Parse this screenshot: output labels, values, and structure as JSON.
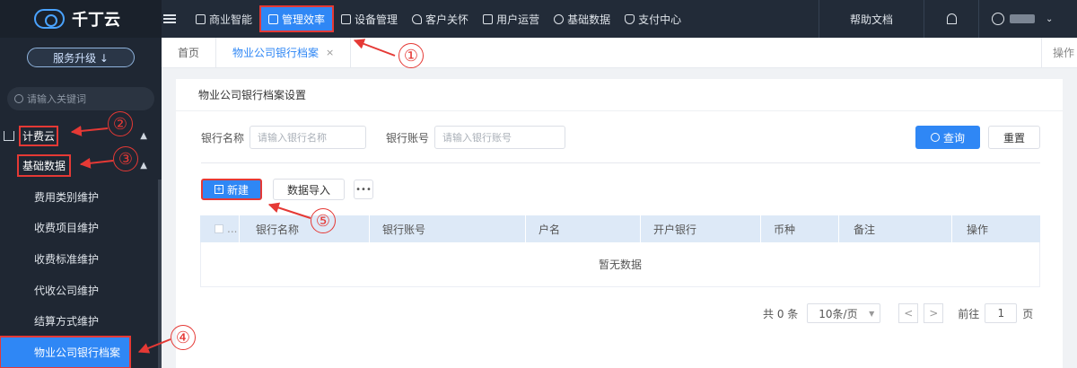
{
  "brand": {
    "name": "千丁云",
    "upgrade_label": "服务升级 ↓"
  },
  "sidebar": {
    "search_placeholder": "请输入关键词",
    "group1": "计费云",
    "group2": "基础数据",
    "items": [
      {
        "label": "费用类别维护"
      },
      {
        "label": "收费项目维护"
      },
      {
        "label": "收费标准维护"
      },
      {
        "label": "代收公司维护"
      },
      {
        "label": "结算方式维护"
      },
      {
        "label": "物业公司银行档案"
      }
    ]
  },
  "topnav": {
    "items": [
      {
        "label": "商业智能"
      },
      {
        "label": "管理效率"
      },
      {
        "label": "设备管理"
      },
      {
        "label": "客户关怀"
      },
      {
        "label": "用户运营"
      },
      {
        "label": "基础数据"
      },
      {
        "label": "支付中心"
      }
    ],
    "help": "帮助文档"
  },
  "tabs": {
    "home": "首页",
    "active": "物业公司银行档案",
    "close": "×",
    "ops": "操作"
  },
  "panel": {
    "title": "物业公司银行档案设置",
    "bank_name_label": "银行名称",
    "bank_name_placeholder": "请输入银行名称",
    "bank_acct_label": "银行账号",
    "bank_acct_placeholder": "请输入银行账号",
    "query": "查询",
    "reset": "重置",
    "new": "新建",
    "import": "数据导入",
    "more": "•••"
  },
  "table": {
    "columns": [
      "...",
      "银行名称",
      "银行账号",
      "户名",
      "开户银行",
      "币种",
      "备注",
      "操作"
    ],
    "empty": "暂无数据"
  },
  "pager": {
    "total": "共 0 条",
    "page_size": "10条/页",
    "goto": "前往",
    "page": "1",
    "page_suffix": "页"
  },
  "callouts": [
    "①",
    "②",
    "③",
    "④",
    "⑤"
  ],
  "colors": {
    "accent": "#2f87f5",
    "annotation": "#e53935",
    "sidebar_bg": "#1f2733"
  }
}
